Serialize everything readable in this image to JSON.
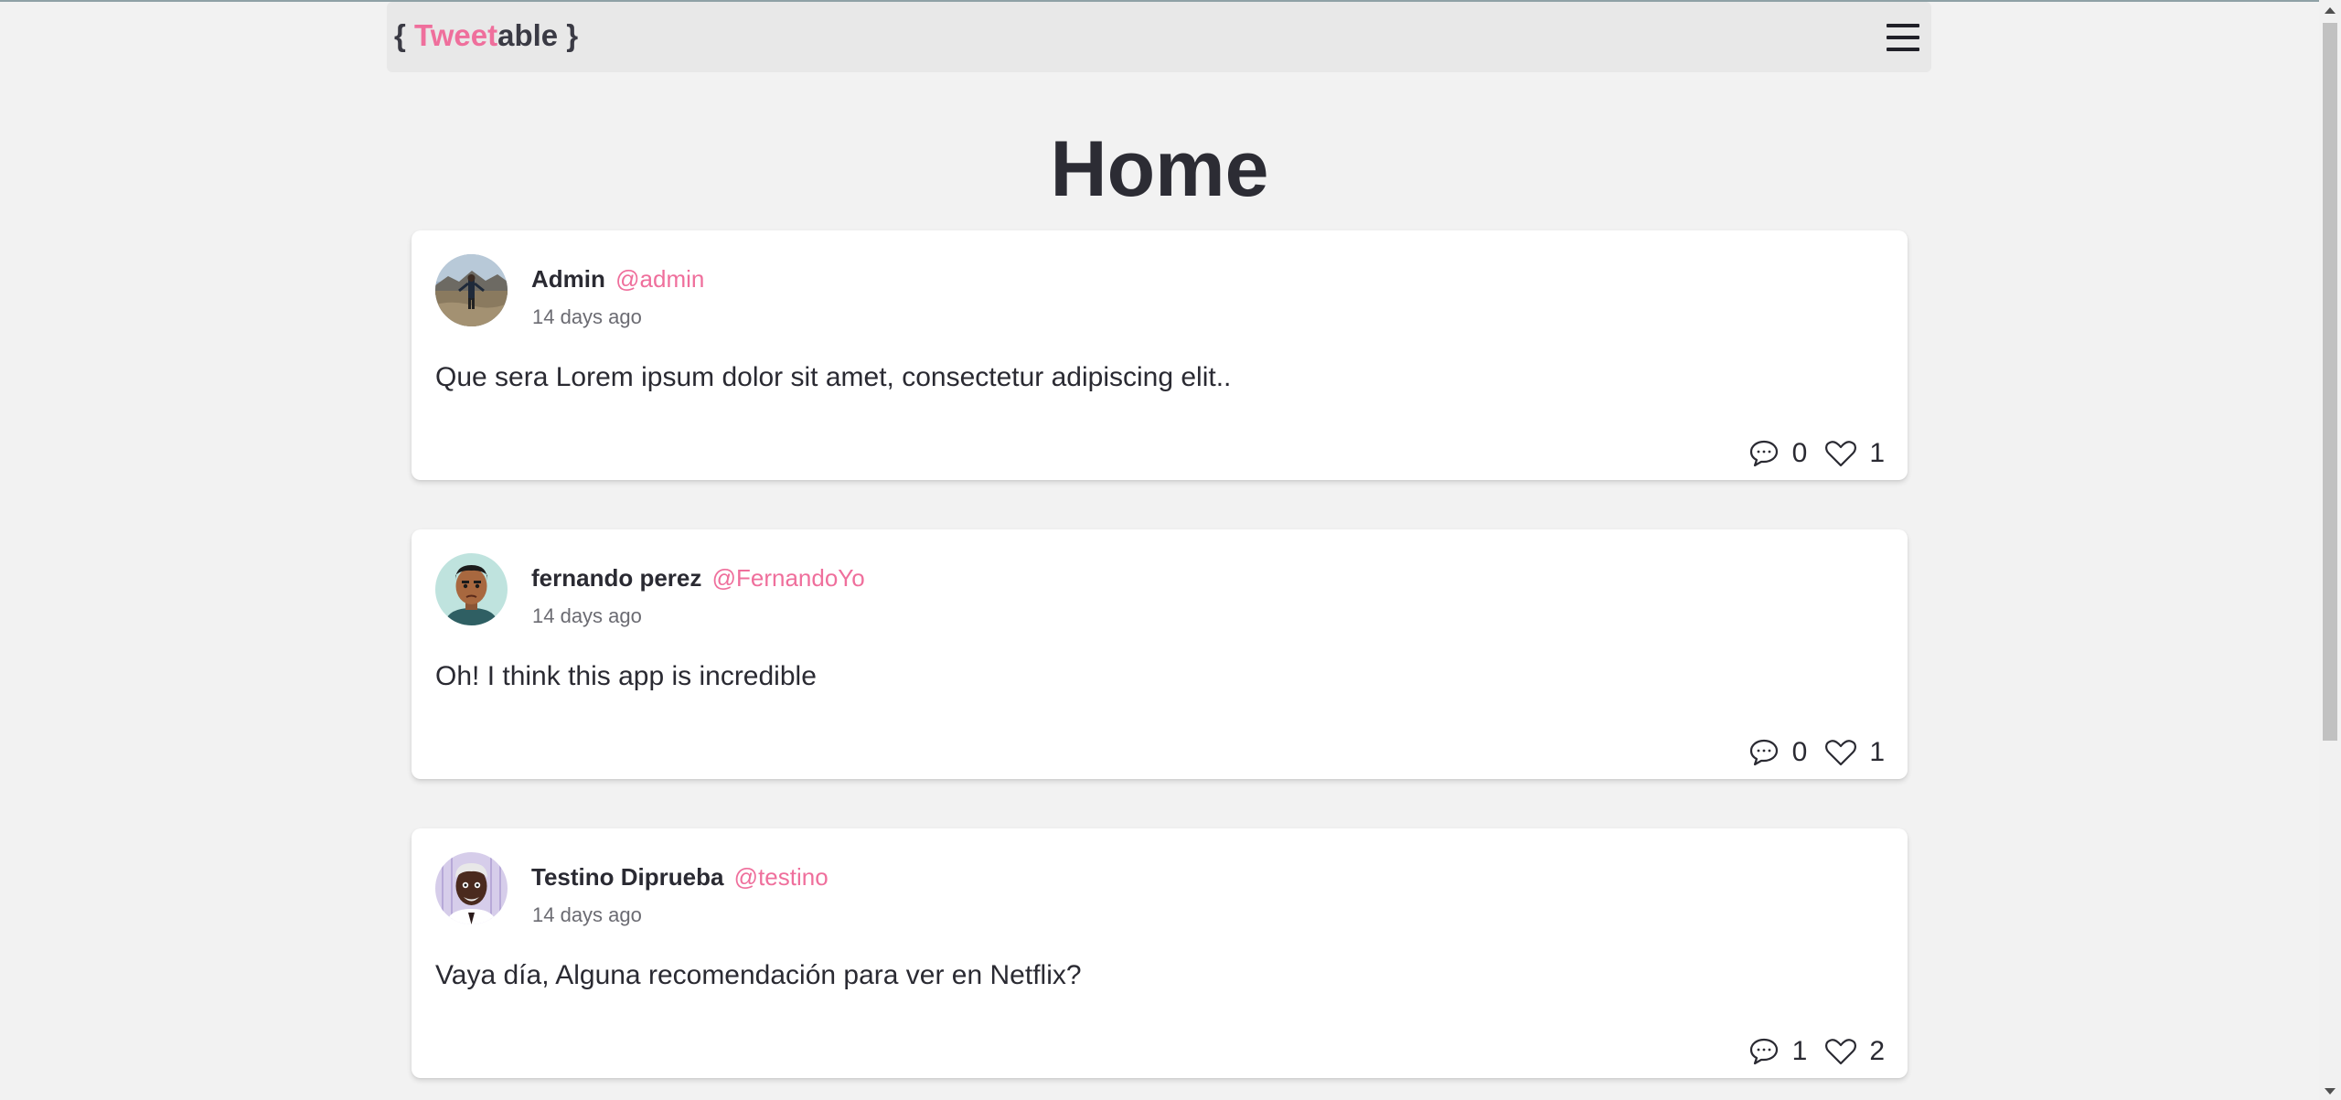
{
  "app": {
    "logo_open": "{ ",
    "logo_tweet": "Tweet",
    "logo_able": "able",
    "logo_close": " }"
  },
  "colors": {
    "accent_pink": "#ef6f9c",
    "background": "#f2f2f2",
    "card": "#ffffff"
  },
  "page": {
    "title": "Home"
  },
  "tweets": [
    {
      "name": "Admin",
      "handle": "@admin",
      "time": "14 days ago",
      "text": "Que sera Lorem ipsum dolor sit amet, consectetur adipiscing elit..",
      "comments": "0",
      "likes": "1",
      "avatar": "landscape-photo-avatar"
    },
    {
      "name": "fernando perez",
      "handle": "@FernandoYo",
      "time": "14 days ago",
      "text": "Oh! I think this app is incredible",
      "comments": "0",
      "likes": "1",
      "avatar": "cartoon-man-avatar"
    },
    {
      "name": "Testino Diprueba",
      "handle": "@testino",
      "time": "14 days ago",
      "text": "Vaya día, Alguna recomendación para ver en Netflix?",
      "comments": "1",
      "likes": "2",
      "avatar": "cartoon-old-man-avatar"
    }
  ],
  "icons": {
    "menu": "hamburger-menu-icon",
    "comment": "speech-bubble-icon",
    "like": "heart-outline-icon"
  }
}
